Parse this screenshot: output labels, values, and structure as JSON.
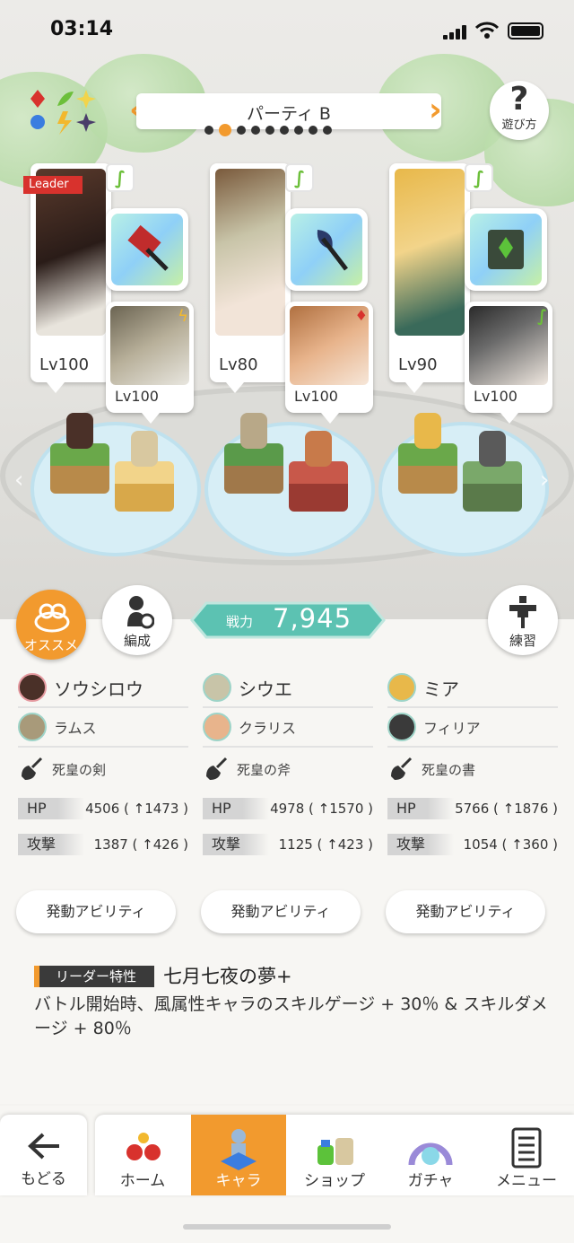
{
  "status_bar": {
    "time": "03:14"
  },
  "header": {
    "party_name": "パーティ B",
    "page_dots": 9,
    "active_dot": 1,
    "help_label": "遊び方",
    "help_symbol": "?"
  },
  "team": [
    {
      "leader_tag": "Leader",
      "main_level": "Lv100",
      "sub_level": "Lv100",
      "main_name": "ソウシロウ",
      "sub_name": "ラムス",
      "weapon": "死皇の剣",
      "hp_label": "HP",
      "hp": "4506 ( ↑1473 )",
      "atk_label": "攻撃",
      "atk": "1387 ( ↑426 )",
      "ability_label": "発動アビリティ"
    },
    {
      "leader_tag": "",
      "main_level": "Lv80",
      "sub_level": "Lv100",
      "main_name": "シウエ",
      "sub_name": "クラリス",
      "weapon": "死皇の斧",
      "hp_label": "HP",
      "hp": "4978 ( ↑1570 )",
      "atk_label": "攻撃",
      "atk": "1125 ( ↑423 )",
      "ability_label": "発動アビリティ"
    },
    {
      "leader_tag": "",
      "main_level": "Lv90",
      "sub_level": "Lv100",
      "main_name": "ミア",
      "sub_name": "フィリア",
      "weapon": "死皇の書",
      "hp_label": "HP",
      "hp": "5766 ( ↑1876 )",
      "atk_label": "攻撃",
      "atk": "1054 ( ↑360 )",
      "ability_label": "発動アビリティ"
    }
  ],
  "buttons": {
    "recommend": "オススメ",
    "formation": "編成",
    "training": "練習"
  },
  "power": {
    "label": "戦力",
    "value": "7,945"
  },
  "leader_trait": {
    "tag": "リーダー特性",
    "name": "七月七夜の夢+",
    "description": "バトル開始時、風属性キャラのスキルゲージ + 30％ & スキルダメージ + 80％"
  },
  "nav": {
    "back": "もどる",
    "tabs": [
      "ホーム",
      "キャラ",
      "ショップ",
      "ガチャ",
      "メニュー"
    ],
    "active": "キャラ"
  },
  "colors": {
    "accent": "#f29a2e",
    "power": "#5cc2b2",
    "leader": "#d8322d",
    "wind": "#6cbf3a"
  }
}
